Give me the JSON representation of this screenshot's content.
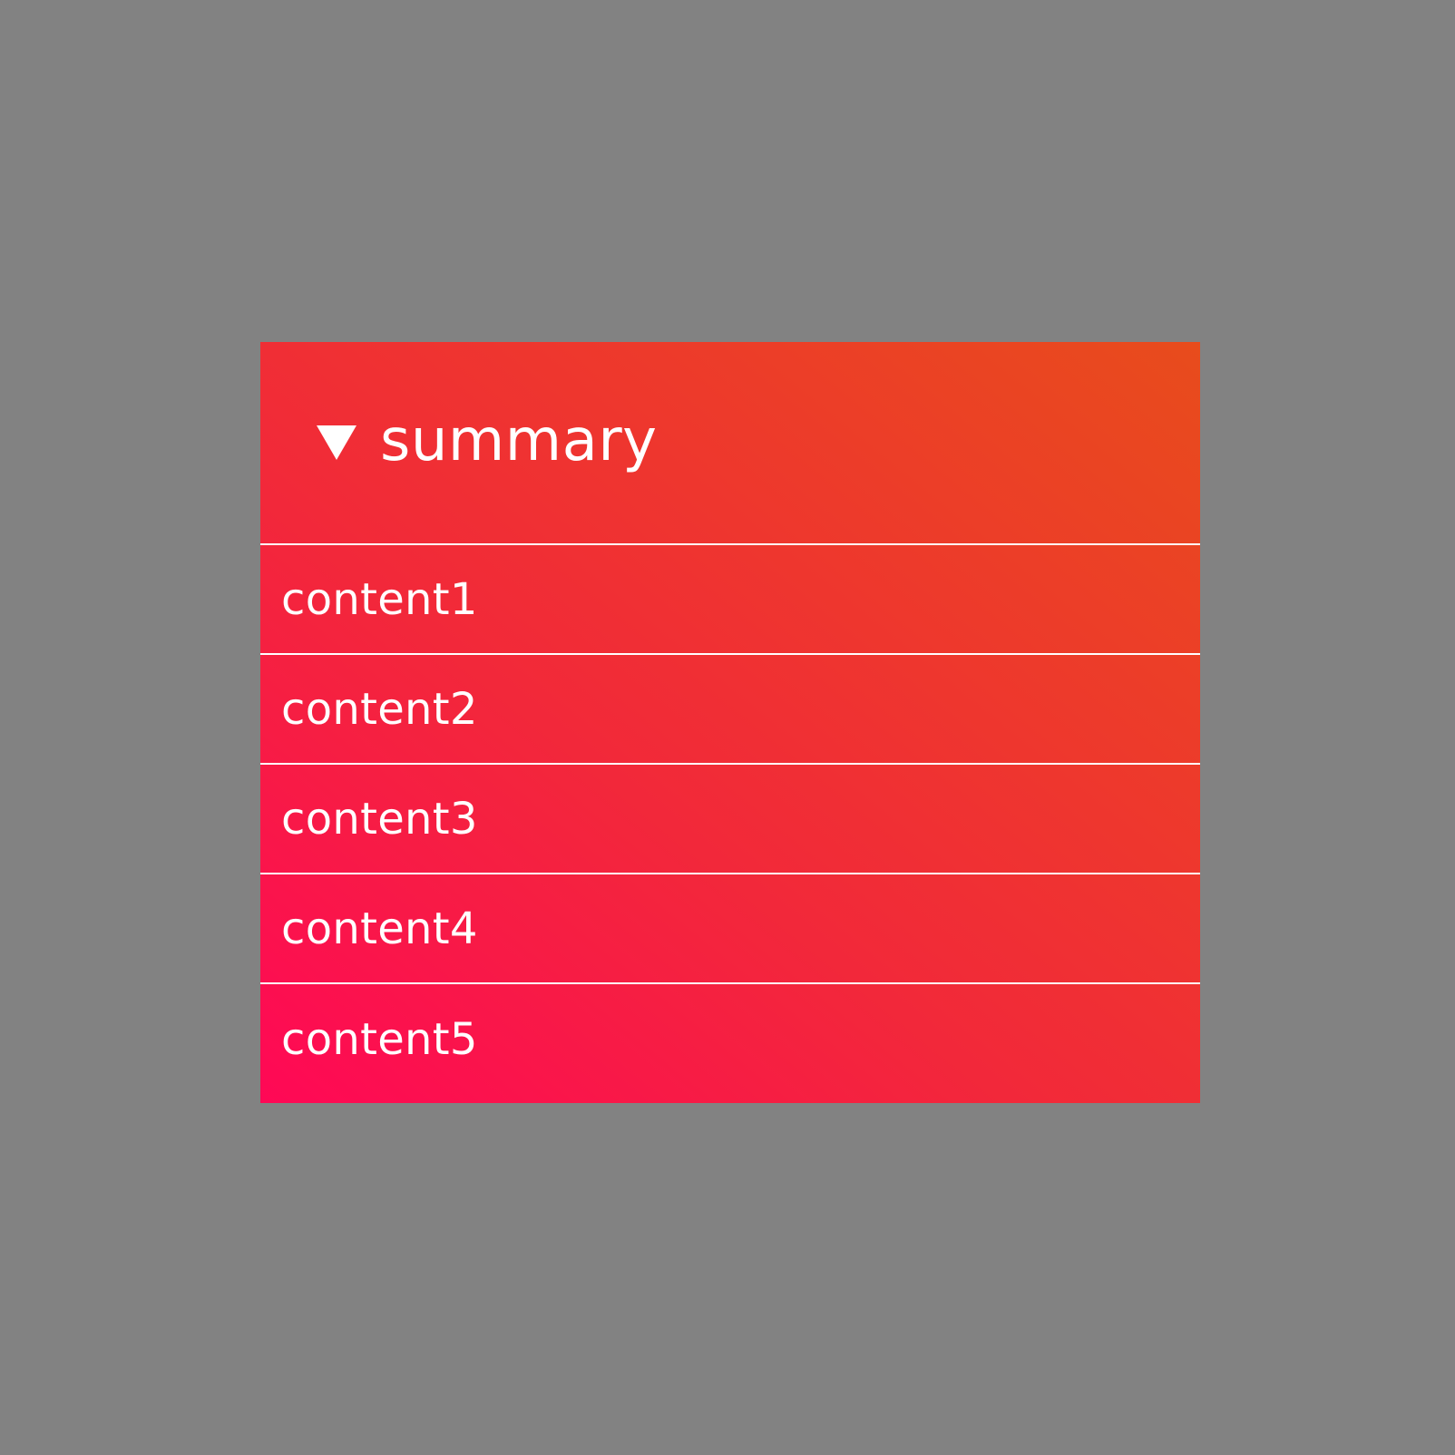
{
  "details": {
    "summary": "summary",
    "arrow_icon": "triangle-down-icon",
    "expanded": true,
    "items": [
      {
        "label": "content1"
      },
      {
        "label": "content2"
      },
      {
        "label": "content3"
      },
      {
        "label": "content4"
      },
      {
        "label": "content5"
      }
    ]
  },
  "colors": {
    "background": "#828282",
    "gradient_start": "#ff0856",
    "gradient_end": "#e84c1c",
    "text": "#ffffff"
  }
}
